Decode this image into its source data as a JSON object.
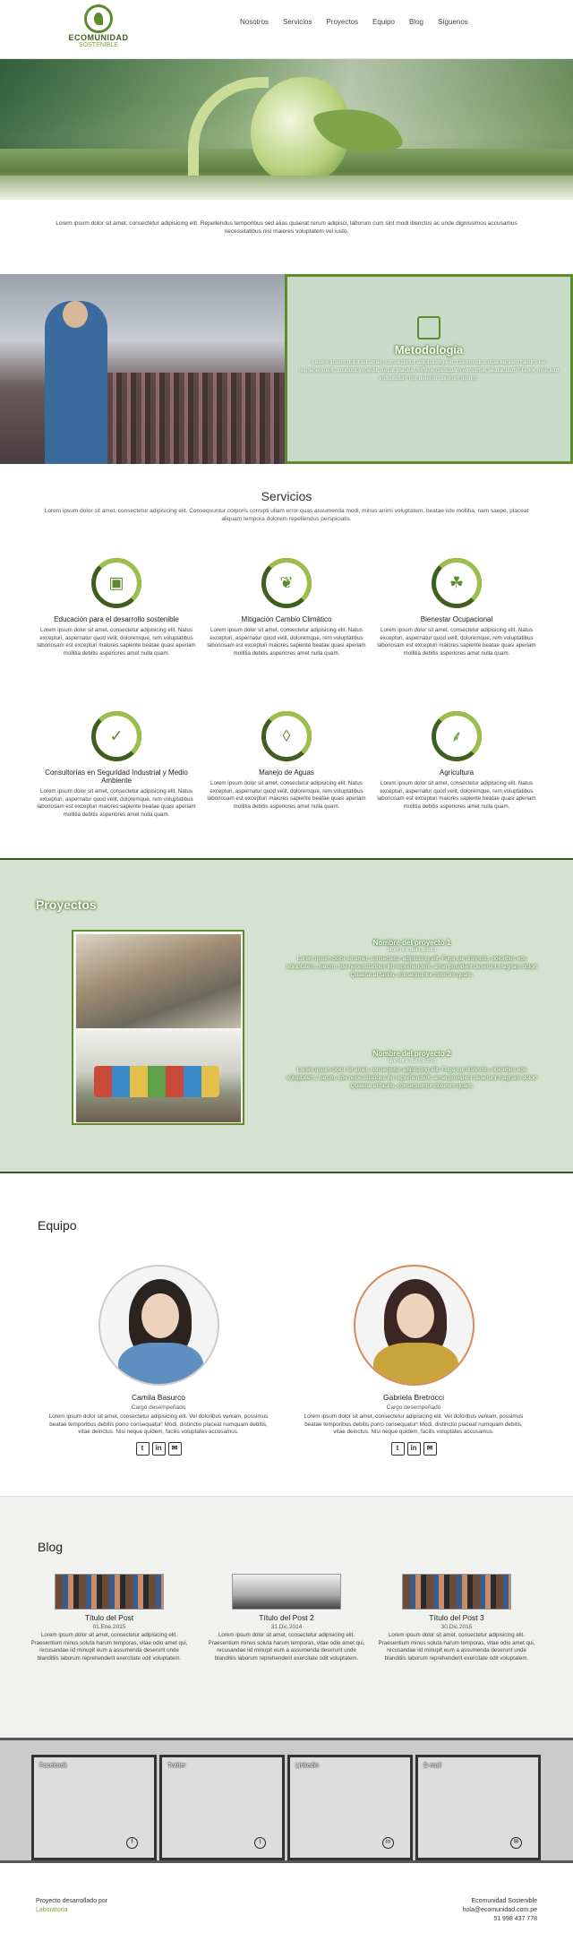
{
  "header": {
    "logo_line1": "ECOMUNIDAD",
    "logo_line2": "SOSTENIBLE",
    "nav": [
      "Nosotros",
      "Servicios",
      "Proyectos",
      "Equipo",
      "Blog",
      "Síguenos"
    ]
  },
  "intro": {
    "text": "Lorem ipsum dolor sit amet, consectetur adipisicing elit. Repellendus temporibus sed alias quaerat rerum adipisci, laborum cum sint modi ibenctus ac unde dignissimos accusamus necessitatibus nisi maiores voluptatem vel iusto."
  },
  "metodologia": {
    "title": "Metodología",
    "text": "Lorem ipsum dolor sit amet, consectetur adipisicing elit. Commodi, culpa veniam harum vel reprehenderit, incidunt impedit, fugiat placeat, officiis quisquam excepturi laudantium? Dolor nesciunt voluptatum qui deleniti dolorum ipsum."
  },
  "servicios": {
    "title": "Servicios",
    "subtitle": "Lorem ipsum dolor sit amet, consectetur adipisicing elit. Consequuntur corporis corrupti ullam error quas assumenda modi, minus animi voluptatem, beatae iste mollitia, nam saepe, placeat aliquam tempora dolorem repellendus perspiciatis.",
    "items": [
      {
        "title": "Educación para el desarrollo sostenible",
        "icon": "presentation-icon",
        "glyph": "▣",
        "text": "Lorem ipsum dolor sit amet, consectetur adipisicing elit. Natus excepturi, aspernatur quod velit, doloremque, rem voluptatibus laboriosam est excepturi maiores sapiente beatae quasi aperiam mollitia debitis asperiores amet nulla quam."
      },
      {
        "title": "Mitigación Cambio Climático",
        "icon": "plant-hand-icon",
        "glyph": "❦",
        "text": "Lorem ipsum dolor sit amet, consectetur adipisicing elit. Natus excepturi, aspernatur quod velit, doloremque, rem voluptatibus laboriosam est excepturi maiores sapiente beatae quasi aperiam mollitia debitis asperiores amet nulla quam."
      },
      {
        "title": "Bienestar Ocupacional",
        "icon": "hands-leaf-icon",
        "glyph": "☘",
        "text": "Lorem ipsum dolor sit amet, consectetur adipisicing elit. Natus excepturi, aspernatur quod velit, doloremque, rem voluptatibus laboriosam est excepturi maiores sapiente beatae quasi aperiam mollitia debitis asperiores amet nulla quam."
      },
      {
        "title": "Consultorías en Seguridad Industrial y Medio Ambiente",
        "icon": "shield-check-icon",
        "glyph": "✓",
        "text": "Lorem ipsum dolor sit amet, consectetur adipisicing elit. Natus excepturi, aspernatur quod velit, doloremque, rem voluptatibus laboriosam est excepturi maiores sapiente beatae quasi aperiam mollitia debitis asperiores amet nulla quam."
      },
      {
        "title": "Manejo de Aguas",
        "icon": "water-drop-icon",
        "glyph": "◊",
        "text": "Lorem ipsum dolor sit amet, consectetur adipisicing elit. Natus excepturi, aspernatur quod velit, doloremque, rem voluptatibus laboriosam est excepturi maiores sapiente beatae quasi aperiam mollitia debitis asperiores amet nulla quam."
      },
      {
        "title": "Agricultura",
        "icon": "wheat-icon",
        "glyph": "⸙",
        "text": "Lorem ipsum dolor sit amet, consectetur adipisicing elit. Natus excepturi, aspernatur quod velit, doloremque, rem voluptatibus laboriosam est excepturi maiores sapiente beatae quasi aperiam mollitia debitis asperiores amet nulla quam."
      }
    ]
  },
  "proyectos": {
    "title": "Proyectos",
    "items": [
      {
        "name": "Nombre del proyecto 1",
        "district": "Nombre del distrito",
        "text": "Lorem ipsum dolor sit amet, consectetur adipisicing elit. Fuga qui distinctio, doloribus eos voluptatem, harum, iste necessitatibus illo reprehenderit, amet provident deserunt magnam dolor! Quaerat at facilis, consequuntur dolorum quam."
      },
      {
        "name": "Nombre del proyecto 2",
        "district": "Nombre del distrito",
        "text": "Lorem ipsum dolor sit amet, consectetur adipisicing elit. Fuga qui distinctio, doloribus eos voluptatem, harum, iste necessitatibus illo reprehenderit, amet provident deserunt magnam dolor! Quaerat at facilis, consequuntur dolorum quam."
      }
    ]
  },
  "equipo": {
    "title": "Equipo",
    "members": [
      {
        "name": "Camila Basurco",
        "role": "Cargo desempeñado",
        "text": "Lorem ipsum dolor sit amet, consectetur adipisicing elit. Vel doloribus veniam, possimus beatae temporibus debitis porro consequatur! Modi, distinctio placeat numquam debitis, vitae deinctus. Nisi neque quidem, facilis voluptates accusamus."
      },
      {
        "name": "Gabriela Bretrocci",
        "role": "Cargo desempeñado",
        "text": "Lorem ipsum dolor sit amet, consectetur adipisicing elit. Vel doloribus veniam, possimus beatae temporibus debitis porro consequatur! Modi, distinctio placeat numquam debitis, vitae deinctus. Nisi neque quidem, facilis voluptates accusamus."
      }
    ],
    "social": [
      "t",
      "in",
      "✉"
    ]
  },
  "blog": {
    "title": "Blog",
    "posts": [
      {
        "title": "Título del Post",
        "date": "01.Ene.2015",
        "text": "Lorem ipsum dolor sit amet, consectetur adipisicing elit. Praesentium minus soluta harum temporas, vitae odio amet qui, recusandae iid minupit eum a assumenda deserunt unde blanditiis laborum reprehenderit exercitate odit voluptatem."
      },
      {
        "title": "Título del Post 2",
        "date": "31.Dic.2014",
        "text": "Lorem ipsum dolor sit amet, consectetur adipisicing elit. Praesentium minus soluta harum temporas, vitae odio amet qui, recusandae iid minupit eum a assumenda deserunt unde blanditiis laborum reprehenderit exercitate odit voluptatem."
      },
      {
        "title": "Título del Post 3",
        "date": "30.Dic.2015",
        "text": "Lorem ipsum dolor sit amet, consectetur adipisicing elit. Praesentium minus soluta harum temporas, vitae odio amet qui, recusandae iid minupit eum a assumenda deserunt unde blanditiis laborum reprehenderit exercitate odit voluptatem."
      }
    ]
  },
  "boxes": [
    {
      "label": "Facebook",
      "glyph": "f"
    },
    {
      "label": "Twitter",
      "glyph": "t"
    },
    {
      "label": "Linkedin",
      "glyph": "in"
    },
    {
      "label": "E-mail",
      "glyph": "✉"
    }
  ],
  "footer": {
    "left_line1": "Proyecto desarrollado por",
    "left_line2": "Laboratoria",
    "right_line1": "Ecomunidad Sostenible",
    "right_line2": "hola@ecomunidad.com.pe",
    "right_line3": "51 998 437 778"
  },
  "colors": {
    "accent": "#5f8a2e",
    "dark_green": "#3f5e1f",
    "light_green": "#9bbf4a",
    "panel": "#c8dcc9"
  }
}
